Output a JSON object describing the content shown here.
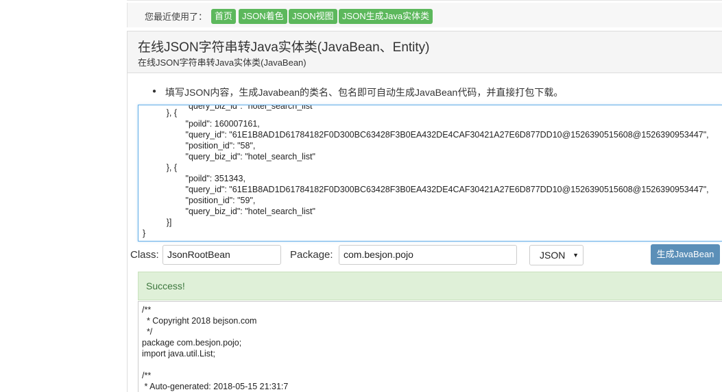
{
  "recent": {
    "label": "您最近使用了：",
    "tags": [
      "首页",
      "JSON着色",
      "JSON视图",
      "JSON生成Java实体类"
    ]
  },
  "panel": {
    "title": "在线JSON字符串转Java实体类(JavaBean、Entity)",
    "subtitle": "在线JSON字符串转Java实体类(JavaBean)"
  },
  "tip": "填写JSON内容，生成Javabean的类名、包名即可自动生成JavaBean代码，并直接打包下载。",
  "editor_lines": [
    "          }, {",
    "                  \"poild\": 160007161,",
    "                  \"query_id\": \"61E1B8AD1D61784182F0D300BC63428F3B0EA432DE4CAF30421A27E6D877DD10@1526390515608@1526390953447\",",
    "                  \"position_id\": \"58\",",
    "                  \"query_biz_id\": \"hotel_search_list\"",
    "          }, {",
    "                  \"poild\": 351343,",
    "                  \"query_id\": \"61E1B8AD1D61784182F0D300BC63428F3B0EA432DE4CAF30421A27E6D877DD10@1526390515608@1526390953447\",",
    "                  \"position_id\": \"59\",",
    "                  \"query_biz_id\": \"hotel_search_list\"",
    "          }]",
    "}"
  ],
  "form": {
    "class_label": "Class:",
    "class_value": "JsonRootBean",
    "package_label": "Package:",
    "package_value": "com.besjon.pojo",
    "format_selected": "JSON",
    "generate_label": "生成JavaBean"
  },
  "status": "Success!",
  "output_lines": [
    "/**",
    "  * Copyright 2018 bejson.com",
    "  */",
    "package com.besjon.pojo;",
    "import java.util.List;",
    "",
    "/**",
    " * Auto-generated: 2018-05-15 21:31:7"
  ]
}
